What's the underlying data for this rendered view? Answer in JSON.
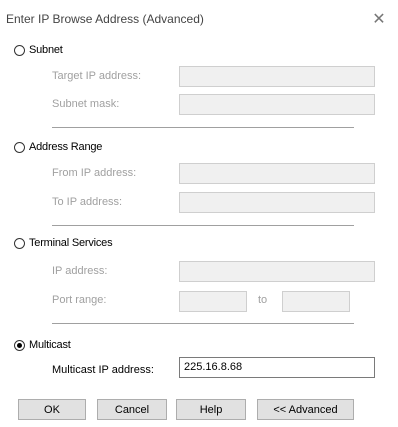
{
  "dialog": {
    "title": "Enter IP Browse Address (Advanced)",
    "close_glyph": "✕"
  },
  "subnet": {
    "label": "Subnet",
    "selected": false,
    "target_ip_label": "Target IP address:",
    "subnet_mask_label": "Subnet mask:",
    "target_ip_value": "",
    "subnet_mask_value": ""
  },
  "address_range": {
    "label": "Address Range",
    "selected": false,
    "from_label": "From IP address:",
    "to_label": "To IP address:",
    "from_value": "",
    "to_value": ""
  },
  "terminal_services": {
    "label": "Terminal Services",
    "selected": false,
    "ip_label": "IP address:",
    "port_range_label": "Port range:",
    "port_to_label": "to",
    "ip_value": "",
    "port_from_value": "",
    "port_to_value": ""
  },
  "multicast": {
    "label": "Multicast",
    "selected": true,
    "ip_label": "Multicast IP address:",
    "ip_value": "225.16.8.68"
  },
  "buttons": {
    "ok": "OK",
    "cancel": "Cancel",
    "help": "Help",
    "advanced": "<< Advanced"
  }
}
